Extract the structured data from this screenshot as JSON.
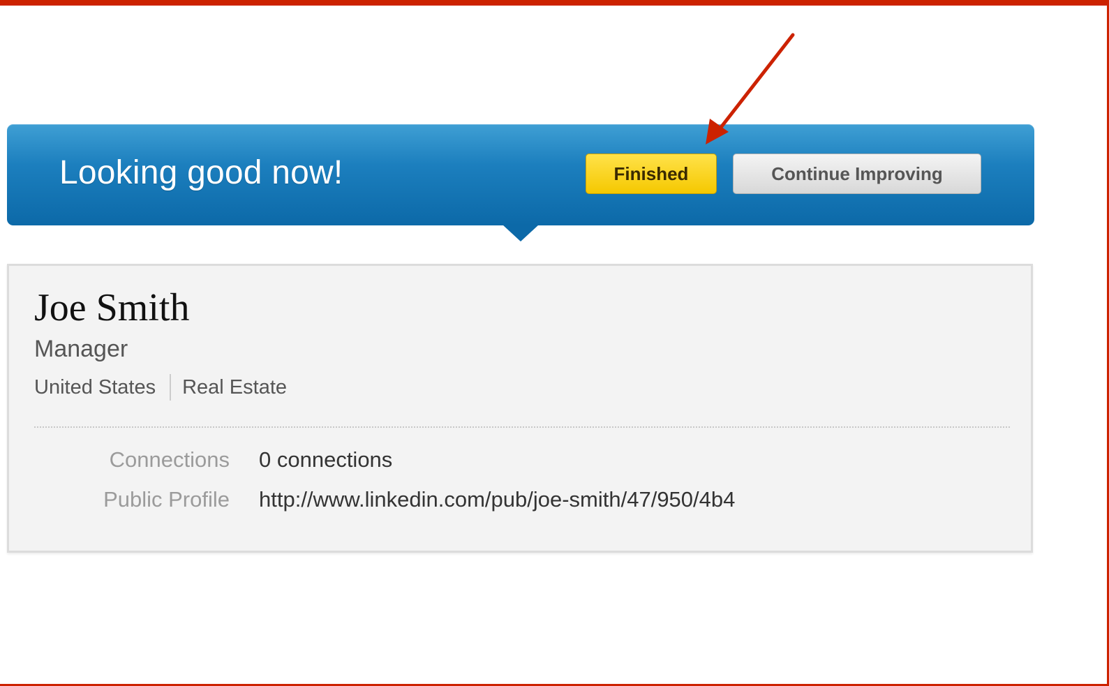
{
  "banner": {
    "title": "Looking good now!",
    "finished_label": "Finished",
    "continue_label": "Continue Improving"
  },
  "profile": {
    "name": "Joe Smith",
    "headline": "Manager",
    "location": "United States",
    "industry": "Real Estate",
    "details": [
      {
        "label": "Connections",
        "value": "0 connections"
      },
      {
        "label": "Public Profile",
        "value": "http://www.linkedin.com/pub/joe-smith/47/950/4b4"
      }
    ]
  },
  "colors": {
    "banner_blue": "#1c7fbe",
    "finished_yellow": "#f5c800",
    "annotation_red": "#cc2200"
  },
  "icons": {
    "annotation": "arrow-pointing-to-finished-button"
  }
}
